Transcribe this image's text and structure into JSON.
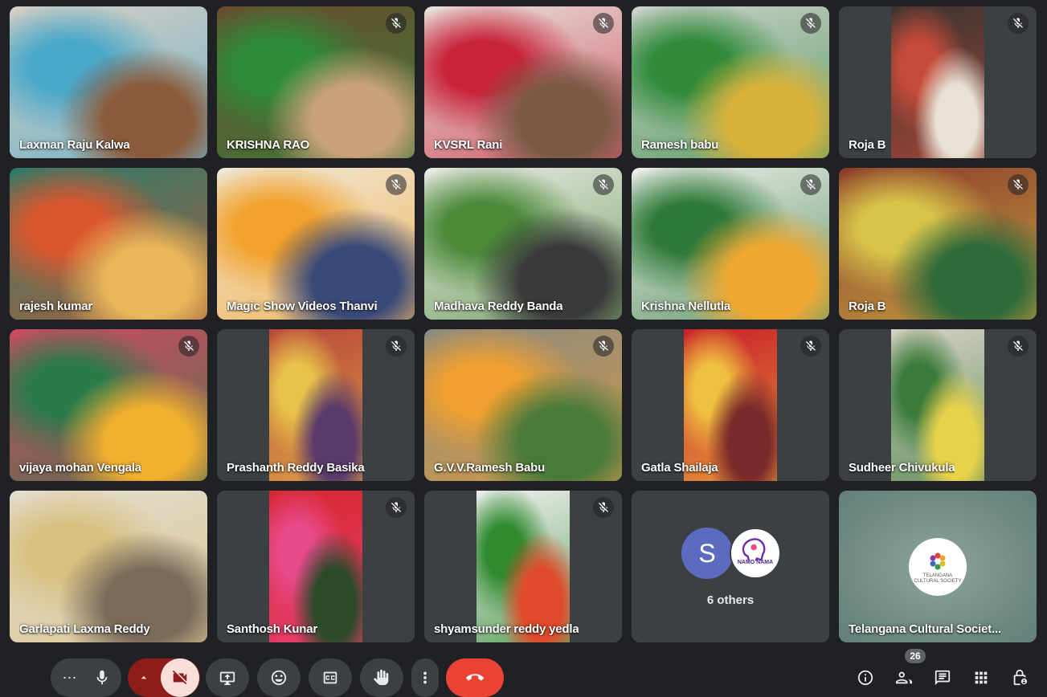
{
  "participants": [
    {
      "name": "Laxman Raju Kalwa",
      "muted": false,
      "narrow": false,
      "scene": [
        "#d9cfc4",
        "#4aa8c9",
        "#8a5a3b"
      ]
    },
    {
      "name": "KRISHNA RAO",
      "muted": true,
      "narrow": false,
      "scene": [
        "#6b4a2e",
        "#2e8b3a",
        "#c9a27a"
      ]
    },
    {
      "name": "KVSRL Rani",
      "muted": true,
      "narrow": false,
      "scene": [
        "#e7e4dc",
        "#c8233a",
        "#7a5a45"
      ]
    },
    {
      "name": "Ramesh babu",
      "muted": true,
      "narrow": false,
      "scene": [
        "#cfd3cf",
        "#2f8a3a",
        "#d8b23a"
      ]
    },
    {
      "name": "Roja B",
      "muted": true,
      "narrow": true,
      "scene": [
        "#3a3430",
        "#c44b3a",
        "#e8e2d4"
      ]
    },
    {
      "name": "rajesh kumar",
      "muted": false,
      "narrow": false,
      "scene": [
        "#2b7a6a",
        "#d9572e",
        "#e9b65a"
      ]
    },
    {
      "name": "Magic Show Videos Thanvi",
      "muted": true,
      "narrow": false,
      "scene": [
        "#efe9da",
        "#f2a12c",
        "#3a4a78"
      ]
    },
    {
      "name": "Madhava Reddy Banda",
      "muted": true,
      "narrow": false,
      "scene": [
        "#ecebe6",
        "#4c8a3a",
        "#3a3a3a"
      ]
    },
    {
      "name": "Krishna Nellutla",
      "muted": true,
      "narrow": false,
      "scene": [
        "#efefec",
        "#2f7a3a",
        "#f0a830"
      ]
    },
    {
      "name": "Roja B",
      "muted": true,
      "narrow": false,
      "scene": [
        "#8a3a2a",
        "#d8c44a",
        "#2f6a3a"
      ]
    },
    {
      "name": "vijaya mohan Vengala",
      "muted": true,
      "narrow": false,
      "scene": [
        "#d04b62",
        "#2a7a4a",
        "#f0b030"
      ]
    },
    {
      "name": "Prashanth Reddy Basika",
      "muted": true,
      "narrow": true,
      "scene": [
        "#b8463a",
        "#e8c24a",
        "#5a3a6a"
      ]
    },
    {
      "name": "G.V.V.Ramesh Babu",
      "muted": true,
      "narrow": false,
      "scene": [
        "#8a8a82",
        "#f0a030",
        "#4a7a3a"
      ]
    },
    {
      "name": "Gatla Shailaja",
      "muted": true,
      "narrow": true,
      "scene": [
        "#c8202a",
        "#f0c040",
        "#7a2a2a"
      ]
    },
    {
      "name": "Sudheer Chivukula",
      "muted": true,
      "narrow": true,
      "scene": [
        "#d8d2c6",
        "#3a7a3a",
        "#e8d24a"
      ]
    },
    {
      "name": "Garlapati Laxma Reddy",
      "muted": false,
      "narrow": false,
      "scene": [
        "#e4ddd0",
        "#d8c080",
        "#7a6a5a"
      ]
    },
    {
      "name": "Santhosh Kunar",
      "muted": true,
      "narrow": true,
      "scene": [
        "#d8262e",
        "#e84a8a",
        "#2a4a2a"
      ]
    },
    {
      "name": "shyamsunder reddy yedla",
      "muted": true,
      "narrow": true,
      "scene": [
        "#efefef",
        "#2f8a2f",
        "#e04a2a"
      ]
    }
  ],
  "others": {
    "avatar_letter": "S",
    "logo_text": "NAMO NAMA",
    "label": "6 others"
  },
  "presenter": {
    "name": "Telangana Cultural Societ...",
    "logo_lines": [
      "TELANGANA",
      "CULTURAL SOCIETY"
    ]
  },
  "toolbar": {
    "more_label": "⋯",
    "participants_count": "26"
  },
  "colors": {
    "background": "#202124",
    "tile": "#3c4043",
    "end_call": "#ea4335",
    "cam_off": "#f9dedc",
    "accent": "#5c6bc0"
  }
}
